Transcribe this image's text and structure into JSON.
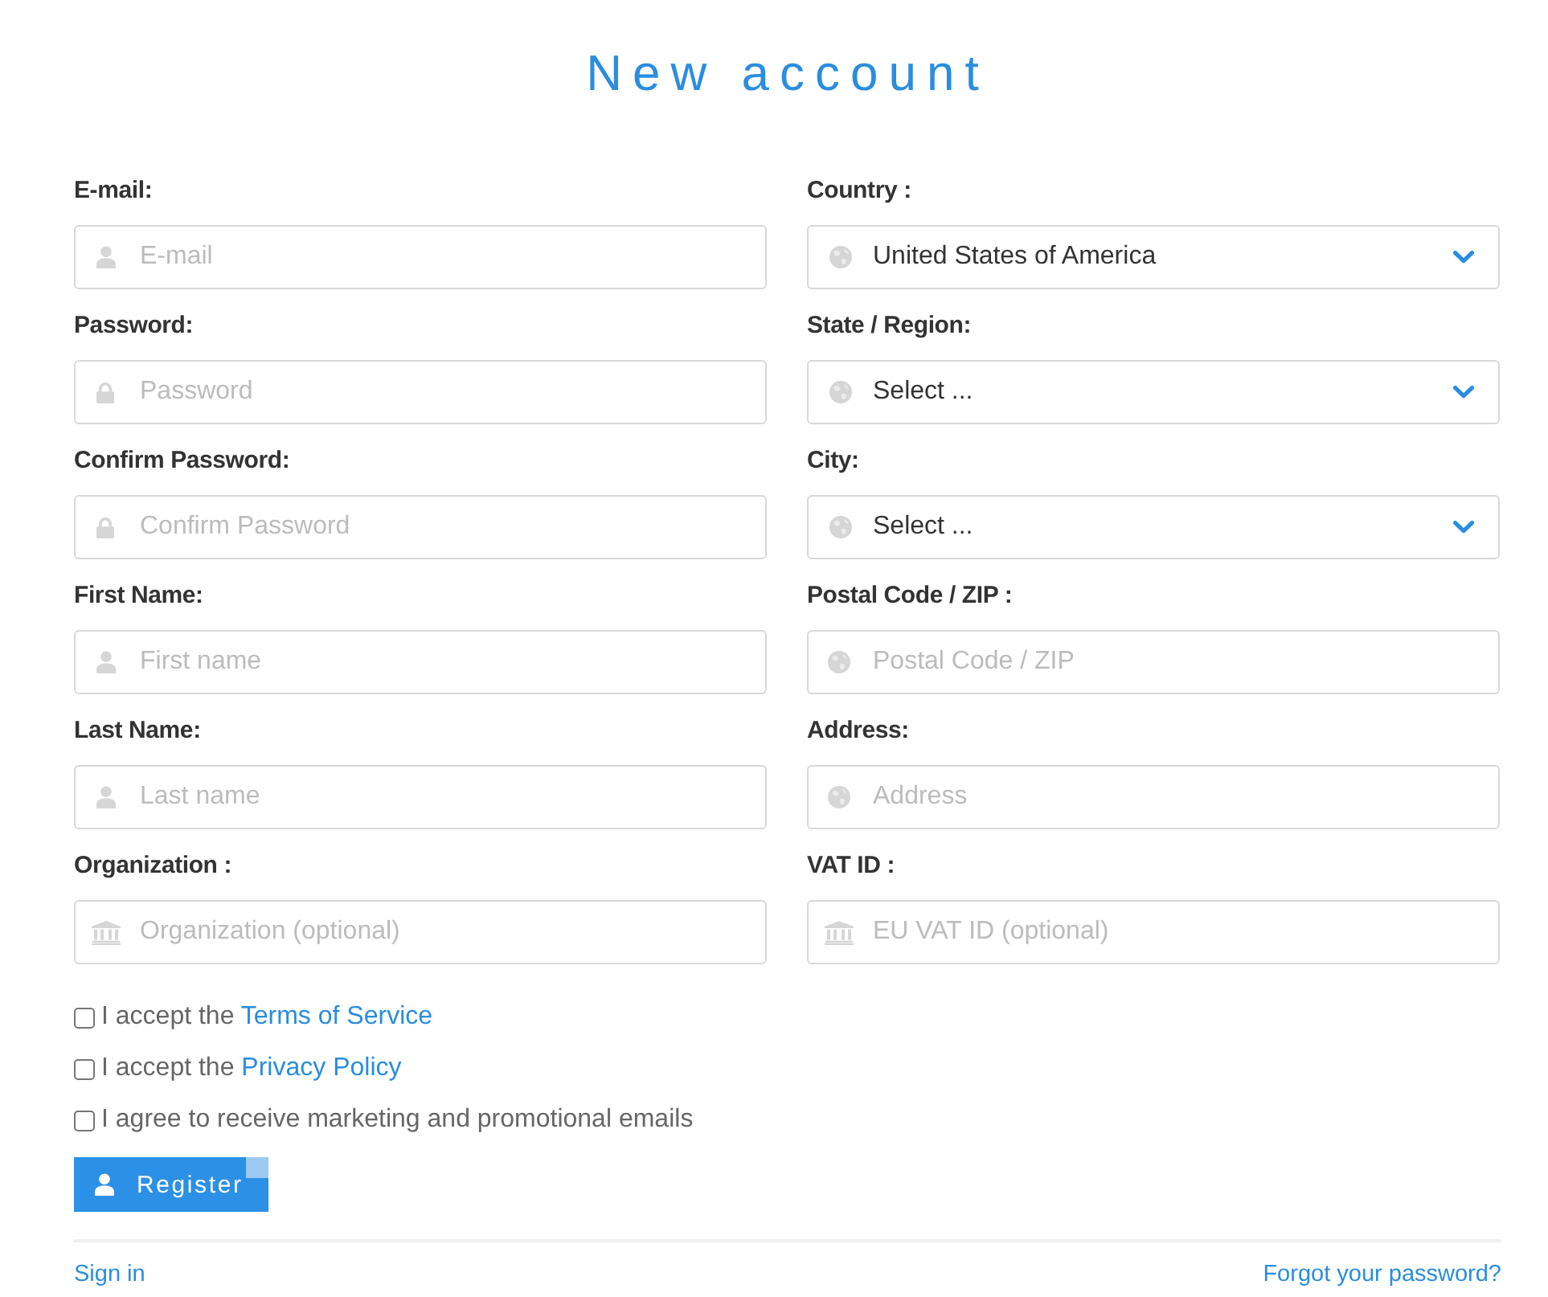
{
  "title": "New account",
  "left_fields": [
    {
      "label": "E-mail:",
      "kind": "input",
      "placeholder": "E-mail"
    },
    {
      "label": "Password:",
      "kind": "input",
      "placeholder": "Password"
    },
    {
      "label": "Confirm Password:",
      "kind": "input",
      "placeholder": "Confirm Password"
    },
    {
      "label": "First Name:",
      "kind": "input",
      "placeholder": "First name"
    },
    {
      "label": "Last Name:",
      "kind": "input",
      "placeholder": "Last name"
    },
    {
      "label": "Organization :",
      "kind": "input",
      "placeholder": "Organization (optional)"
    }
  ],
  "right_fields": [
    {
      "label": "Country :",
      "kind": "select",
      "value": "United States of America"
    },
    {
      "label": "State / Region:",
      "kind": "select",
      "value": "Select ..."
    },
    {
      "label": "City:",
      "kind": "select",
      "value": "Select ..."
    },
    {
      "label": "Postal Code / ZIP :",
      "kind": "input",
      "placeholder": "Postal Code / ZIP"
    },
    {
      "label": "Address:",
      "kind": "input",
      "placeholder": "Address"
    },
    {
      "label": "VAT ID :",
      "kind": "input",
      "placeholder": "EU VAT ID (optional)"
    }
  ],
  "agreements": [
    {
      "text": "I accept the",
      "link": "Terms of Service",
      "checked": false
    },
    {
      "text": "I accept the",
      "link": "Privacy Policy",
      "checked": false
    },
    {
      "text": "I agree to receive marketing and promotional emails",
      "checked": false
    }
  ],
  "register_button": {
    "label": "Register"
  },
  "footer": {
    "sign_in": "Sign in",
    "forgot_password": "Forgot your password?"
  }
}
